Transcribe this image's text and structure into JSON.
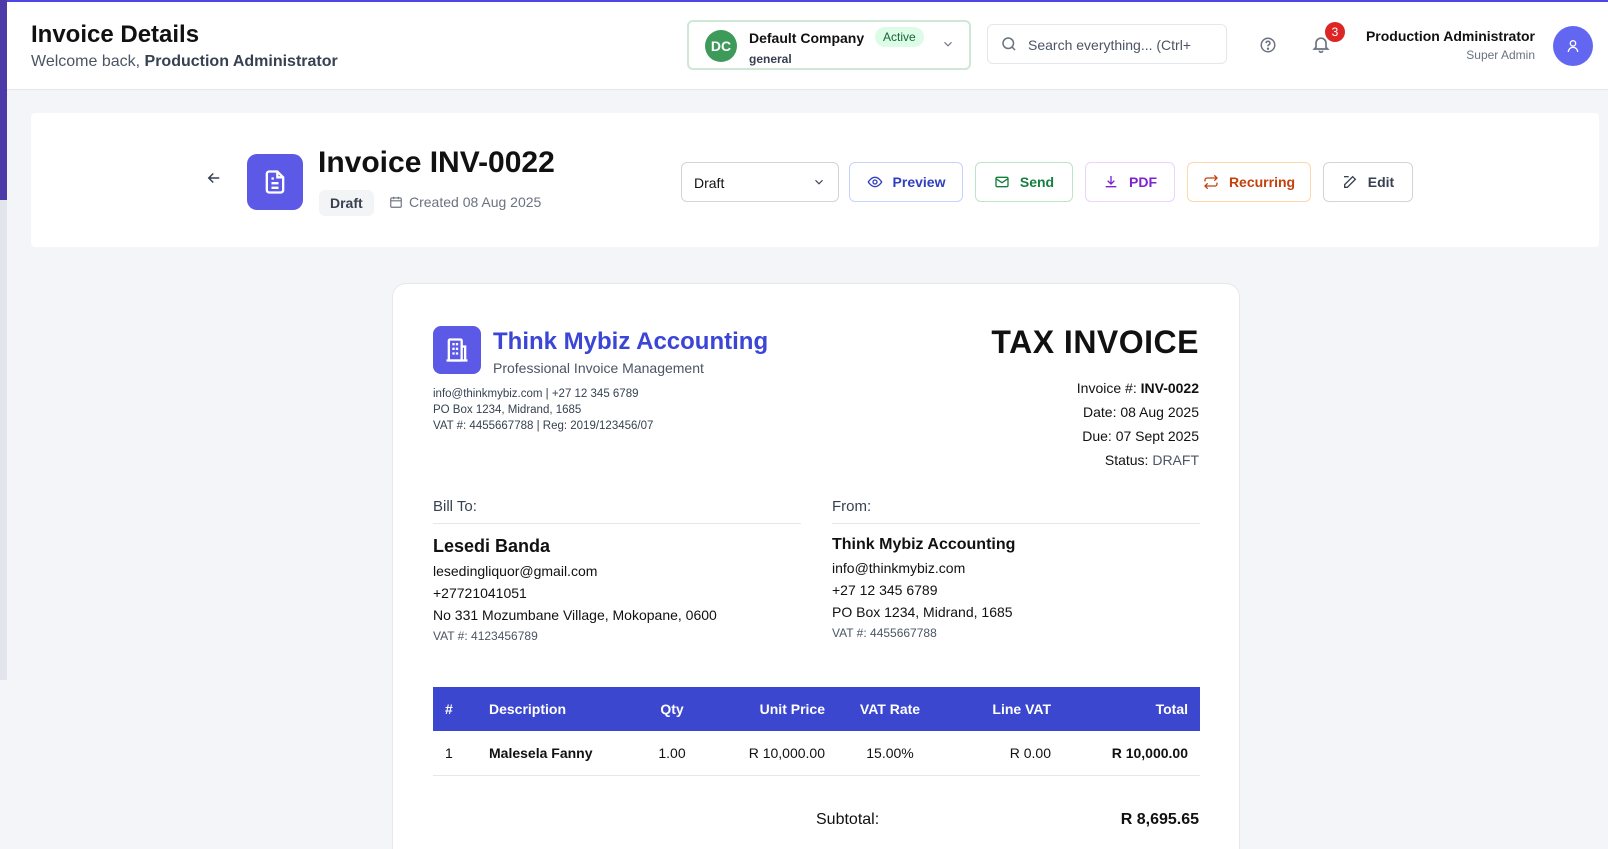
{
  "header": {
    "title": "Invoice Details",
    "welcome_prefix": "Welcome back, ",
    "welcome_user": "Production Administrator"
  },
  "company": {
    "initials": "DC",
    "name": "Default Company",
    "status": "Active",
    "sub": "general"
  },
  "search": {
    "placeholder": "Search everything... (Ctrl+"
  },
  "notifications": {
    "count": "3"
  },
  "user": {
    "name": "Production Administrator",
    "role": "Super Admin"
  },
  "invoice_header": {
    "title": "Invoice INV-0022",
    "status_pill": "Draft",
    "created": "Created 08 Aug 2025",
    "status_select": "Draft",
    "buttons": {
      "preview": "Preview",
      "send": "Send",
      "pdf": "PDF",
      "recurring": "Recurring",
      "edit": "Edit"
    }
  },
  "invoice": {
    "business_name": "Think Mybiz Accounting",
    "tagline": "Professional Invoice Management",
    "contact_line1": "info@thinkmybiz.com | +27 12 345 6789",
    "contact_line2": "PO Box 1234, Midrand, 1685",
    "contact_line3": "VAT #: 4455667788 | Reg: 2019/123456/07",
    "doc_title": "TAX INVOICE",
    "number_label": "Invoice #: ",
    "number": "INV-0022",
    "date": "Date: 08 Aug 2025",
    "due": "Due: 07 Sept 2025",
    "status_label": "Status: ",
    "status": "DRAFT",
    "bill_to": {
      "label": "Bill To:",
      "name": "Lesedi Banda",
      "email": "lesedingliquor@gmail.com",
      "phone": "+27721041051",
      "address": "No 331 Mozumbane Village, Mokopane, 0600",
      "vat": "VAT #: 4123456789"
    },
    "from": {
      "label": "From:",
      "name": "Think Mybiz Accounting",
      "email": "info@thinkmybiz.com",
      "phone": "+27 12 345 6789",
      "address": "PO Box 1234, Midrand, 1685",
      "vat": "VAT #: 4455667788"
    },
    "table": {
      "headers": [
        "#",
        "Description",
        "Qty",
        "Unit Price",
        "VAT Rate",
        "Line VAT",
        "Total"
      ],
      "rows": [
        [
          "1",
          "Malesela Fanny",
          "1.00",
          "R 10,000.00",
          "15.00%",
          "R 0.00",
          "R 10,000.00"
        ]
      ]
    },
    "subtotal_label": "Subtotal:",
    "subtotal_value": "R 8,695.65"
  },
  "colors": {
    "primary": "#3b47cf",
    "accent_tile": "#5b59e6",
    "company_avatar": "#3d9a5b"
  }
}
